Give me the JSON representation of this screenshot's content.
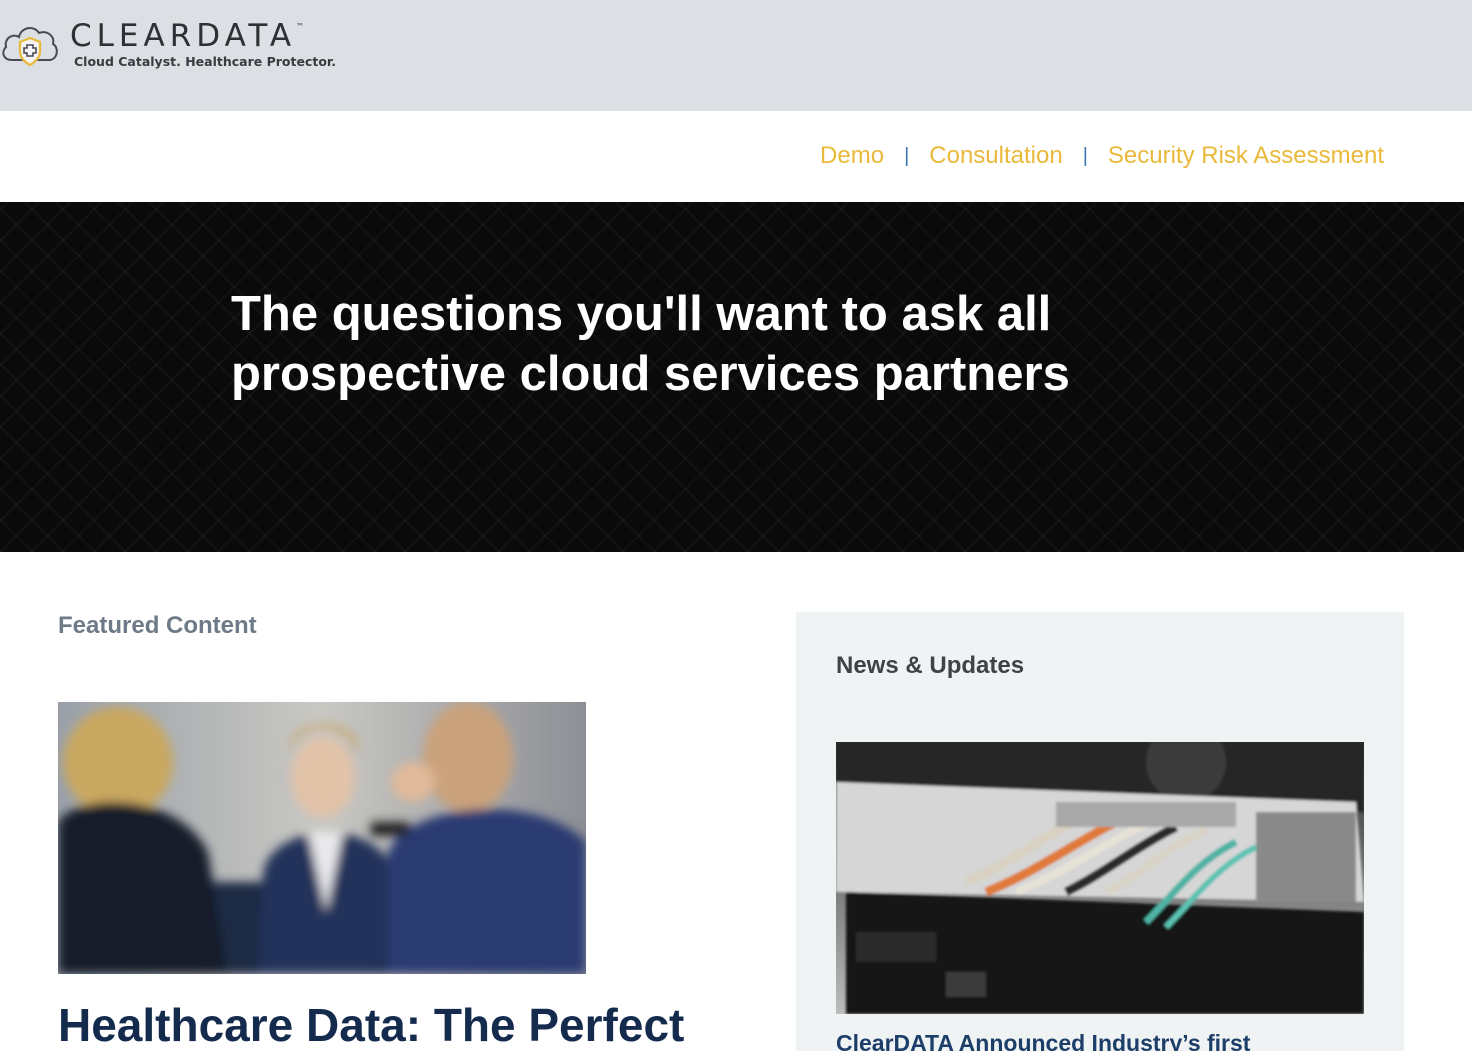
{
  "header": {
    "logo_word": "CLEARDATA",
    "logo_tm": "™",
    "tagline": "Cloud Catalyst. Healthcare Protector."
  },
  "nav": {
    "links": [
      "Demo",
      "Consultation",
      "Security Risk Assessment"
    ],
    "separator": "|",
    "link_color": "#e9b93a",
    "separator_color": "#3a77b0"
  },
  "hero": {
    "title": "The questions you'll want to ask all prospective cloud services partners",
    "background": "#0a0a0a"
  },
  "featured": {
    "label": "Featured Content",
    "image_icon": "business-meeting-photo",
    "title": "Healthcare Data: The Perfect"
  },
  "news": {
    "label": "News & Updates",
    "image_icon": "server-rack-cables-photo",
    "headline": "ClearDATA Announced Industry’s first"
  },
  "colors": {
    "header_bg": "#dcdfe3",
    "brand_navy": "#152b4e",
    "panel_bg": "#f0f3f4"
  }
}
